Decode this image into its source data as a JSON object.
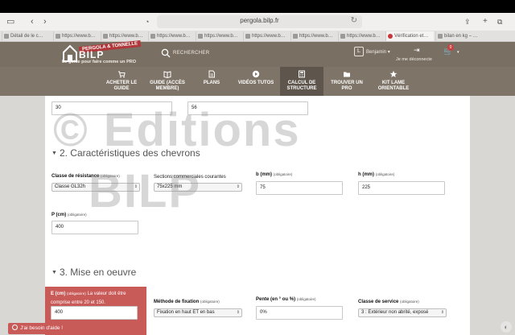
{
  "browser": {
    "url": "pergola.bilp.fr",
    "tabs": [
      "Détail de le c…",
      "https://www.b…",
      "https://www.b…",
      "https://www.b…",
      "https://www.b…",
      "https://www.b…",
      "https://www.b…",
      "https://www.b…",
      "Vérification et…",
      "bilan en kg – …"
    ]
  },
  "header": {
    "logo_ribbon": "PERGOLA & TONNELLE",
    "logo_brand": "BILP",
    "logo_tagline": "Le guide pour faire comme un PRO",
    "search_label": "RECHERCHER",
    "user_initial": "L",
    "user_name": "Benjamin",
    "logout_label": "Je me déconnecte",
    "cart_count": "0"
  },
  "nav": [
    {
      "label": "ACHETER LE GUIDE",
      "icon": "cart-icon"
    },
    {
      "label": "GUIDE (ACCÈS MEMBRE)",
      "icon": "book-icon"
    },
    {
      "label": "PLANS",
      "icon": "document-icon"
    },
    {
      "label": "VIDÉOS TUTOS",
      "icon": "play-icon"
    },
    {
      "label": "CALCUL DE STRUCTURE",
      "icon": "calculator-icon"
    },
    {
      "label": "TROUVER UN PRO",
      "icon": "folder-icon"
    },
    {
      "label": "KIT LAME ORIENTABLE",
      "icon": "star-icon"
    }
  ],
  "form": {
    "top_fields": {
      "field1_value": "30",
      "field2_value": "56"
    },
    "section2": {
      "title": "2. Caractéristiques des chevrons",
      "classe_label": "Classe de résistance",
      "classe_value": "Classe GL32h",
      "sections_label": "Sections commerciales courantes",
      "sections_value": "75x225 mm",
      "b_label": "b (mm)",
      "b_value": "75",
      "h_label": "h (mm)",
      "h_value": "225",
      "p_label": "P (cm)",
      "p_value": "400",
      "required": "(obligatoire)"
    },
    "section3": {
      "title": "3. Mise en oeuvre",
      "e_label": "E (cm)",
      "e_error": "La valeur doit être comprise entre 20 et 150.",
      "e_value": "400",
      "methode_label": "Méthode de fixation",
      "methode_value": "Fixation en haut ET en bas",
      "pente_label": "Pente (en ° ou %)",
      "pente_value": "0%",
      "classe_service_label": "Classe de service",
      "classe_service_value": "3 : Extérieur non abrité, exposé"
    }
  },
  "watermark": {
    "line1": "© Editions",
    "line2": "BILP"
  },
  "help_button": "J'ai besoin d'aide !",
  "colors": {
    "header": "#7a6f63",
    "nav": "#7f7468",
    "nav_active": "#5e554c",
    "error": "#c85a58",
    "brand_red": "#b0383b"
  }
}
